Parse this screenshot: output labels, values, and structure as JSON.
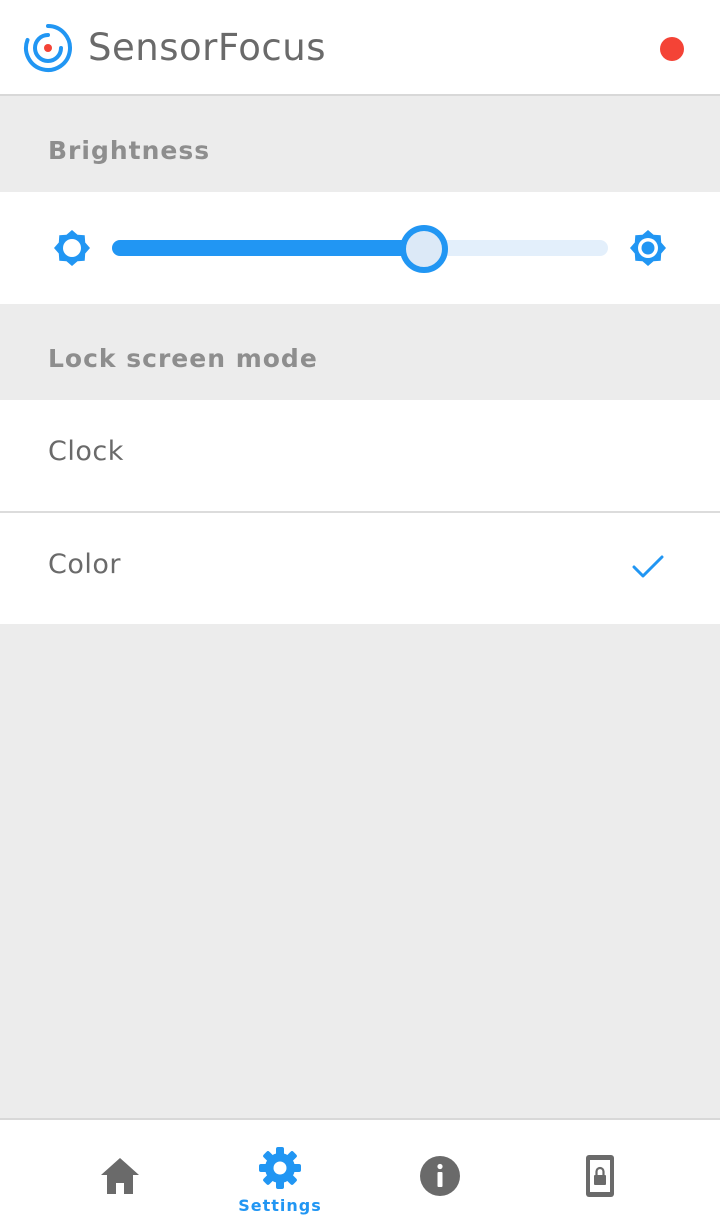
{
  "app": {
    "title": "SensorFocus"
  },
  "colors": {
    "accent": "#2196f3",
    "status_dot": "#f44336",
    "icon_inactive": "#6a6a6a"
  },
  "brightness": {
    "header": "Brightness",
    "level": 0.63,
    "min_icon": "brightness-low-icon",
    "max_icon": "brightness-high-icon"
  },
  "lock_screen_mode": {
    "header": "Lock screen mode",
    "options": [
      {
        "label": "Clock",
        "selected": false
      },
      {
        "label": "Color",
        "selected": true
      }
    ]
  },
  "bottom_nav": {
    "items": [
      {
        "icon": "home-icon",
        "label": "",
        "active": false
      },
      {
        "icon": "gear-icon",
        "label": "Settings",
        "active": true
      },
      {
        "icon": "info-icon",
        "label": "",
        "active": false
      },
      {
        "icon": "phone-lock-icon",
        "label": "",
        "active": false
      }
    ]
  }
}
